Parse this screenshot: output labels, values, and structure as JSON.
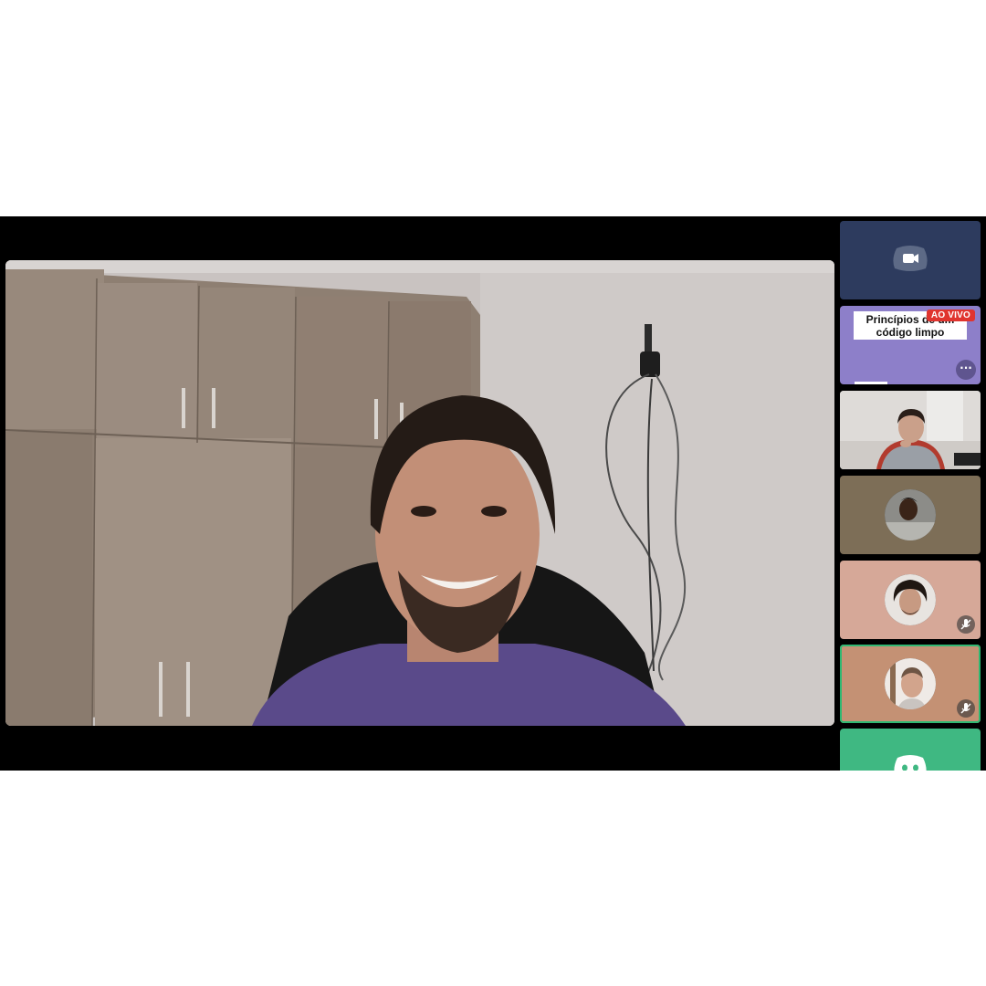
{
  "participants": [
    {
      "kind": "camera-off",
      "icon": "video-camera-icon",
      "color": "#2d3b5e"
    },
    {
      "kind": "screen-share",
      "live_badge": "AO VIVO",
      "title_line1": "Princípios de um",
      "title_line2": "código limpo",
      "more_label": "···",
      "color": "#8d7fc9"
    },
    {
      "kind": "video",
      "color": "#d9d6d4"
    },
    {
      "kind": "avatar",
      "color": "#7d6e57",
      "muted": false
    },
    {
      "kind": "avatar",
      "color": "#d6a898",
      "muted": true
    },
    {
      "kind": "avatar",
      "color": "#c49174",
      "muted": true,
      "speaking": true
    },
    {
      "kind": "camera-off",
      "icon": "discord-logo-icon",
      "color": "#3fb882"
    }
  ],
  "colors": {
    "background": "#000000",
    "speaking_ring": "#2fb872",
    "live_badge": "#e0342e"
  }
}
